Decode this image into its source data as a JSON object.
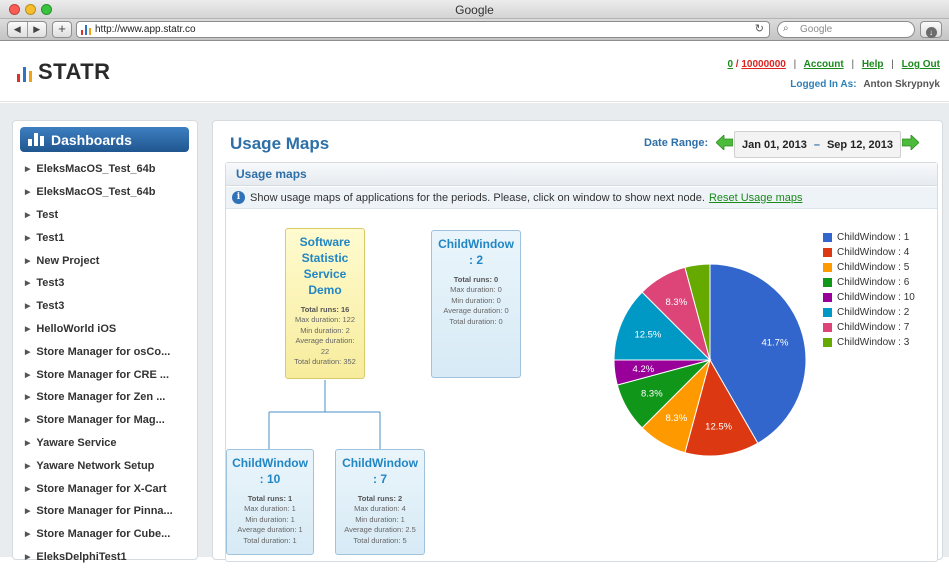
{
  "browser": {
    "window_title": "Google",
    "url": "http://www.app.statr.co",
    "search_placeholder": "Google",
    "back_icon": "chevron-left-icon",
    "forward_icon": "chevron-right-icon"
  },
  "header": {
    "logo_text": "STATR",
    "logo_colors": [
      "#e0302b",
      "#2e74c0",
      "#f0a215"
    ],
    "runs_used": "0",
    "runs_separator": "/",
    "runs_limit": "10000000",
    "links": {
      "account": "Account",
      "help": "Help",
      "logout": "Log Out"
    },
    "logged_in_label": "Logged In As:",
    "user_name": "Anton Skrypnyk"
  },
  "sidebar": {
    "title": "Dashboards",
    "items": [
      "EleksMacOS_Test_64b",
      "EleksMacOS_Test_64b",
      "Test",
      "Test1",
      "New Project",
      "Test3",
      "Test3",
      "HelloWorld iOS",
      "Store Manager for osCo...",
      "Store Manager for CRE ...",
      "Store Manager for Zen ...",
      "Store Manager for Mag...",
      "Yaware Service",
      "Yaware Network Setup",
      "Store Manager for X-Cart",
      "Store Manager for Pinna...",
      "Store Manager for Cube...",
      "EleksDelphiTest1"
    ]
  },
  "main": {
    "title": "Usage Maps",
    "date_range_label": "Date Range:",
    "date_from": "Jan 01, 2013",
    "date_sep": "–",
    "date_to": "Sep 12, 2013",
    "panel_title": "Usage maps",
    "info_text": "Show usage maps of applications for the periods. Please, click on window to show next node.",
    "reset_link": "Reset Usage maps"
  },
  "nodes": {
    "root": {
      "title_lines": [
        "Software",
        "Statistic",
        "Service",
        "Demo"
      ],
      "stats": [
        "Total runs: 16",
        "Max duration: 122",
        "Min duration: 2",
        "Average duration:",
        "22",
        "Total duration: 352"
      ]
    },
    "cw2": {
      "title_lines": [
        "ChildWindow",
        ": 2"
      ],
      "stats": [
        "Total runs: 0",
        "Max duration: 0",
        "Min duration: 0",
        "Average duration: 0",
        "Total duration: 0"
      ]
    },
    "cw10": {
      "title_lines": [
        "ChildWindow",
        ": 10"
      ],
      "stats": [
        "Total runs: 1",
        "Max duration: 1",
        "Min duration: 1",
        "Average duration: 1",
        "Total duration: 1"
      ]
    },
    "cw7": {
      "title_lines": [
        "ChildWindow",
        ": 7"
      ],
      "stats": [
        "Total runs: 2",
        "Max duration: 4",
        "Min duration: 1",
        "Average duration: 2.5",
        "Total duration: 5"
      ]
    }
  },
  "chart_data": {
    "type": "pie",
    "legend_position": "right",
    "slices": [
      {
        "name": "ChildWindow : 1",
        "value": 41.7,
        "label": "41.7%",
        "color": "#3366cc"
      },
      {
        "name": "ChildWindow : 4",
        "value": 12.5,
        "label": "12.5%",
        "color": "#dc3912"
      },
      {
        "name": "ChildWindow : 5",
        "value": 8.3,
        "label": "8.3%",
        "color": "#ff9900"
      },
      {
        "name": "ChildWindow : 6",
        "value": 8.3,
        "label": "8.3%",
        "color": "#109618"
      },
      {
        "name": "ChildWindow : 10",
        "value": 4.2,
        "label": "4.2%",
        "color": "#990099"
      },
      {
        "name": "ChildWindow : 2",
        "value": 12.5,
        "label": "12.5%",
        "color": "#0099c6"
      },
      {
        "name": "ChildWindow : 7",
        "value": 8.3,
        "label": "8.3%",
        "color": "#dd4477"
      },
      {
        "name": "ChildWindow : 3",
        "value": 4.2,
        "label": "",
        "color": "#66aa00"
      }
    ]
  }
}
